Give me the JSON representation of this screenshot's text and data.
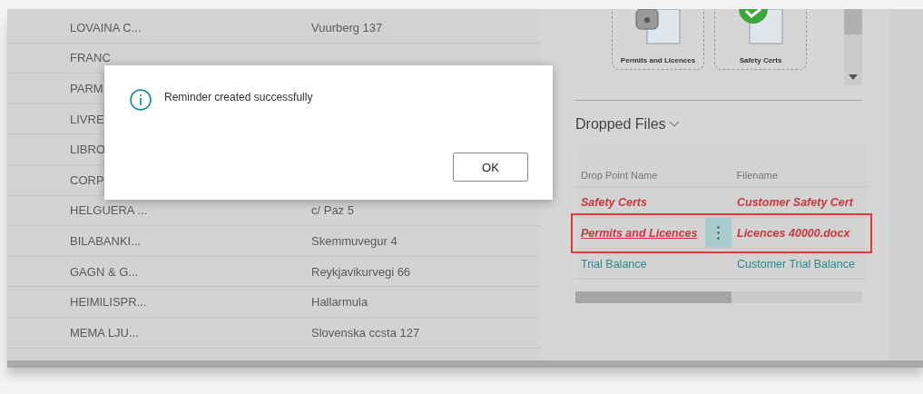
{
  "customers": [
    {
      "name": "LOVAINA C...",
      "address": "Vuurberg 137"
    },
    {
      "name": "FRANC"
    },
    {
      "name": "PARM"
    },
    {
      "name": "LIVRE"
    },
    {
      "name": "LIBRO"
    },
    {
      "name": "CORP"
    },
    {
      "name": "HELGUERA ...",
      "address": "c/ Paz 5"
    },
    {
      "name": "BILABANKI...",
      "address": "Skemmuvegur 4"
    },
    {
      "name": "GAGN & G...",
      "address": "Reykjavikurvegi 66"
    },
    {
      "name": "HEIMILISPR...",
      "address": "Hallarmula"
    },
    {
      "name": "MEMA LJU...",
      "address": "Slovenska ccsta 127"
    }
  ],
  "drop_points": [
    {
      "kind": "lock",
      "label": "Permits and Licences"
    },
    {
      "kind": "check",
      "label": "Safety Certs"
    }
  ],
  "dropped_files": {
    "title": "Dropped Files",
    "columns": [
      "Drop Point Name",
      "Filename"
    ],
    "rows": [
      {
        "drop_point": "Safety Certs",
        "filename": "Customer Safety Cert",
        "flagged": true,
        "selected": false
      },
      {
        "drop_point": "Permits and Licences",
        "filename": "Licences 40000.docx",
        "flagged": true,
        "selected": true
      },
      {
        "drop_point": "Trial Balance",
        "filename": "Customer Trial Balance",
        "flagged": false,
        "selected": false
      }
    ]
  },
  "dialog": {
    "message": "Reminder created successfully",
    "button": "OK"
  }
}
